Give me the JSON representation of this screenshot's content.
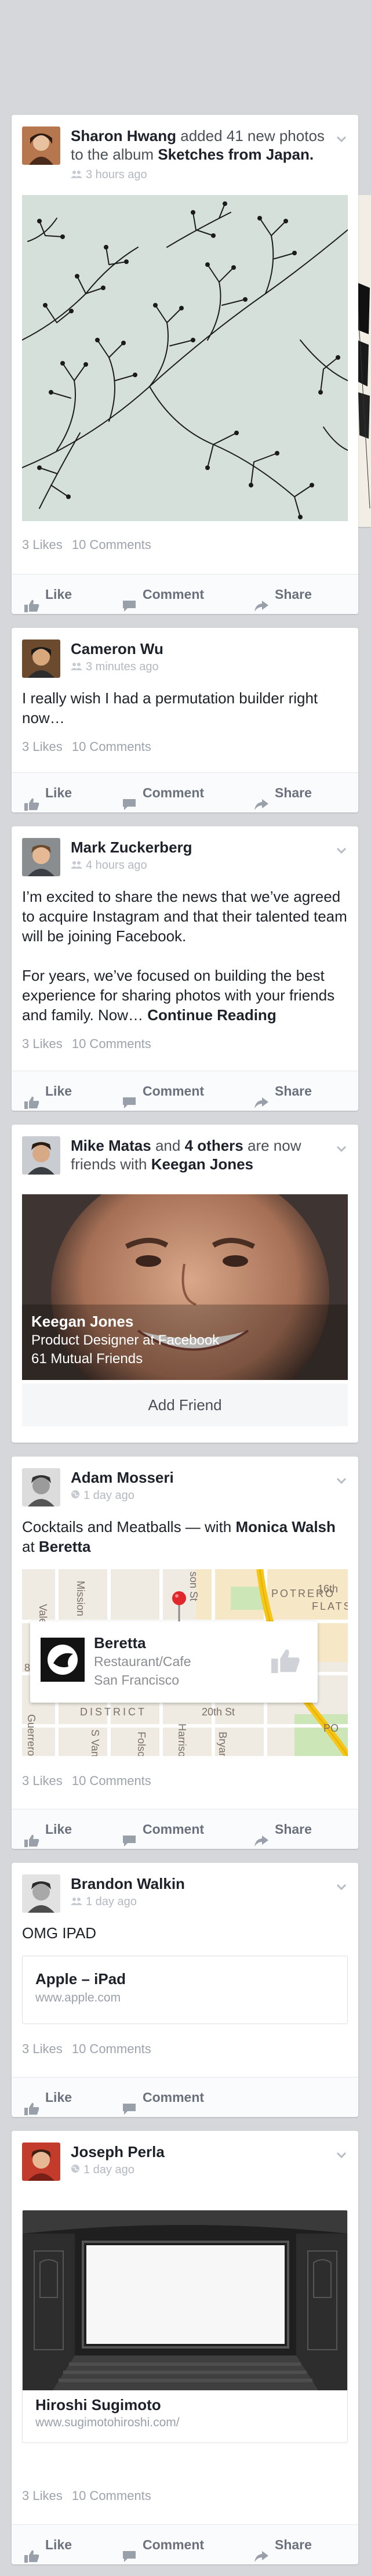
{
  "colors": {
    "background": "#d6d7db",
    "card": "#ffffff",
    "link": "#3b5998",
    "meta": "#b3b8c1",
    "action": "#6b717c",
    "pin": "#e0272c"
  },
  "posts": [
    {
      "author": "Sharon Hwang",
      "action": "added 41 new photos to the album",
      "album": "Sketches from Japan.",
      "time": "3 hours ago",
      "likes": "3 Likes",
      "comments": "10 Comments"
    },
    {
      "author": "Cameron Wu",
      "time": "3 minutes ago",
      "text": "I really wish I had a permutation builder right now…",
      "likes": "3 Likes",
      "comments": "10 Comments"
    },
    {
      "author": "Mark Zuckerberg",
      "time": "4 hours ago",
      "text1": "I’m excited to share the news that we’ve agreed to acquire Instagram and that their talented team will be joining Facebook.",
      "text2": "For years, we’ve focused on building the best experience for sharing photos with your friends and family. Now…",
      "continue": "Continue Reading",
      "likes": "3 Likes",
      "comments": "10 Comments"
    },
    {
      "author": "Mike Matas",
      "and": "and",
      "others": "4 others",
      "are": "are now friends with",
      "friend": "Keegan Jones",
      "friend_title": "Product Designer at Facebook",
      "mutual": "61 Mutual Friends",
      "add_friend": "Add Friend"
    },
    {
      "author": "Adam Mosseri",
      "time": "1 day ago",
      "text": "Cocktails and Meatballs — with",
      "with": "Monica Walsh",
      "at": "at",
      "place": "Beretta",
      "place_type": "Restaurant/Cafe",
      "place_city": "San Francisco",
      "likes": "3 Likes",
      "comments": "10 Comments"
    },
    {
      "author": "Brandon Walkin",
      "time": "1 day ago",
      "text": "OMG IPAD",
      "link_title": "Apple – iPad",
      "link_url": "www.apple.com",
      "likes": "3 Likes",
      "comments": "10 Comments"
    },
    {
      "author": "Joseph Perla",
      "time": "1 day ago",
      "link_title": "Hiroshi Sugimoto",
      "link_url": "www.sugimotohiroshi.com/",
      "likes": "3 Likes",
      "comments": "10 Comments"
    }
  ],
  "map_labels": [
    "Valencia",
    "Mission",
    "Hampshire",
    "POTRERO",
    "16th",
    "DISTRICT",
    "20th St",
    "Guerrero",
    "S Van Ness",
    "Folsom",
    "Harrison",
    "Bryant",
    "8th",
    "FLATS",
    "PO",
    "son St"
  ],
  "actions": {
    "like": "Like",
    "comment": "Comment",
    "share": "Share"
  }
}
